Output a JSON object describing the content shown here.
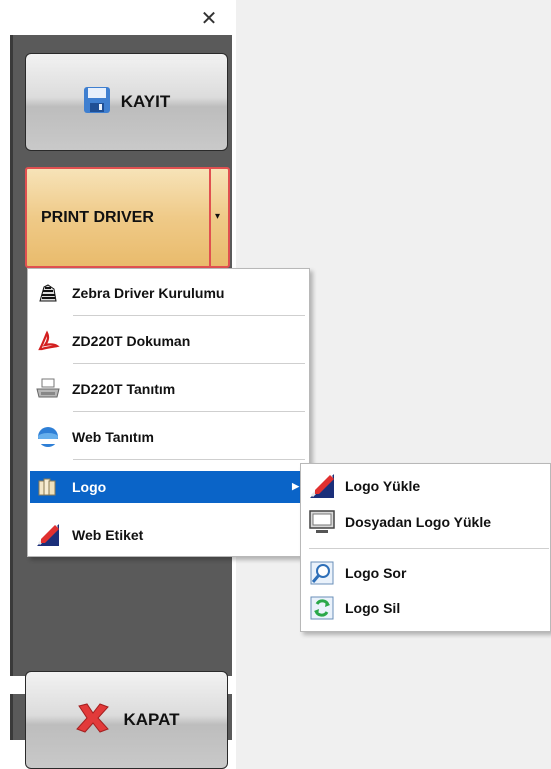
{
  "window": {
    "close_glyph": "✕"
  },
  "buttons": {
    "save_label": "KAYIT",
    "print_driver_label": "PRINT DRIVER",
    "print_driver_arrow": "▾",
    "close_label": "KAPAT"
  },
  "menu": {
    "items": [
      {
        "label": "Zebra Driver Kurulumu",
        "icon": "zebra-icon"
      },
      {
        "label": "ZD220T Dokuman",
        "icon": "pdf-icon"
      },
      {
        "label": "ZD220T Tanıtım",
        "icon": "printer-icon"
      },
      {
        "label": "Web Tanıtım",
        "icon": "web-globe-icon"
      },
      {
        "label": "Logo",
        "icon": "logo-icon",
        "highlighted": true,
        "has_submenu": true
      },
      {
        "label": "Web Etiket",
        "icon": "pen-ruler-icon"
      }
    ],
    "submenu_arrow": "▶"
  },
  "submenu": {
    "items": [
      {
        "label": "Logo Yükle",
        "icon": "pen-ruler-icon"
      },
      {
        "label": "Dosyadan Logo Yükle",
        "icon": "monitor-icon"
      },
      {
        "label": "Logo Sor",
        "icon": "magnify-icon"
      },
      {
        "label": "Logo Sil",
        "icon": "refresh-icon"
      }
    ]
  },
  "colors": {
    "highlight": "#0a64c8",
    "sidebar": "#5a5a5a",
    "print_border": "#e05050"
  }
}
